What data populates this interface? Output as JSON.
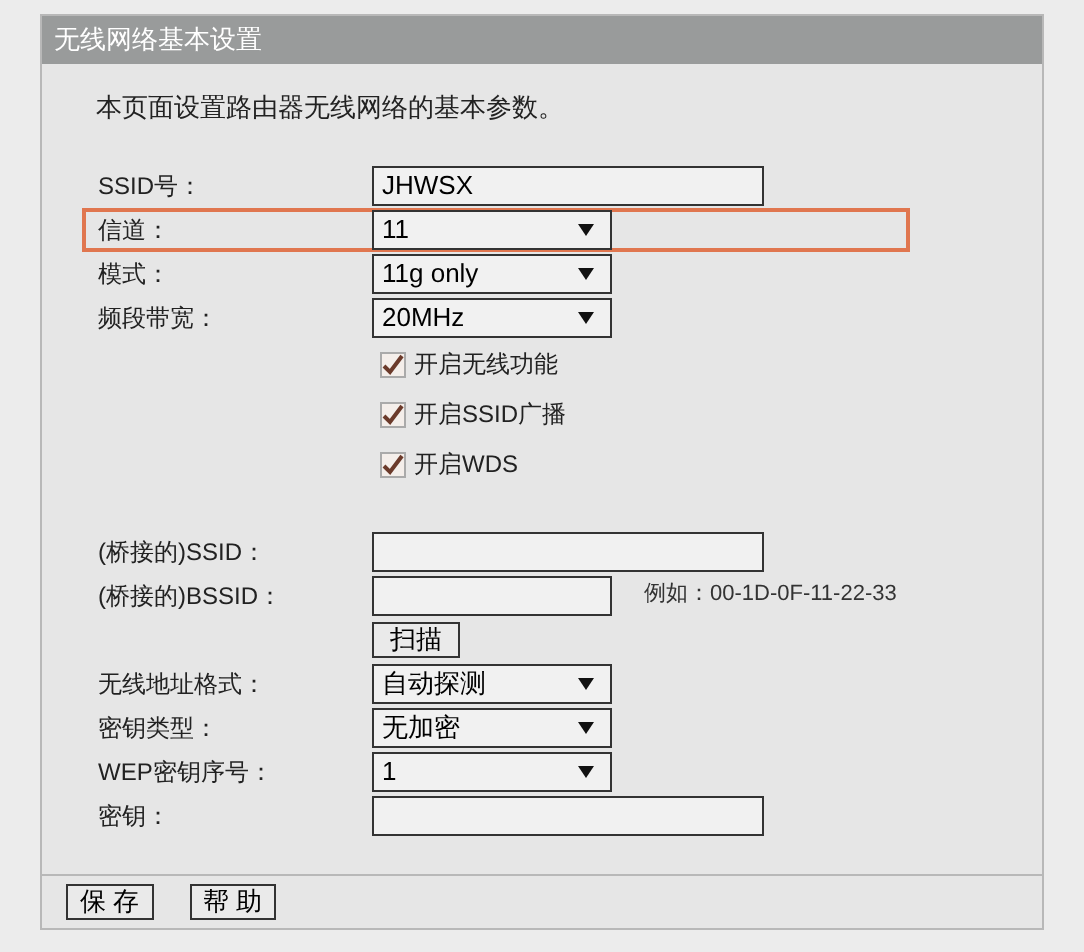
{
  "panel": {
    "title": "无线网络基本设置",
    "description": "本页面设置路由器无线网络的基本参数。"
  },
  "groups": [
    [
      {
        "kind": "text",
        "label": "SSID号：",
        "value": "JHWSX",
        "highlighted": false
      },
      {
        "kind": "select",
        "label": "信道：",
        "value": "11",
        "highlighted": true
      },
      {
        "kind": "select",
        "label": "模式：",
        "value": "11g only",
        "highlighted": false
      },
      {
        "kind": "select",
        "label": "频段带宽：",
        "value": "20MHz",
        "highlighted": false
      },
      {
        "kind": "checkbox",
        "label": "开启无线功能",
        "checked": true,
        "highlighted": false
      },
      {
        "kind": "checkbox",
        "label": "开启SSID广播",
        "checked": true,
        "highlighted": false
      },
      {
        "kind": "checkbox",
        "label": "开启WDS",
        "checked": true,
        "highlighted": false
      }
    ],
    [
      {
        "kind": "text",
        "label": "(桥接的)SSID：",
        "highlighted": false
      },
      {
        "kind": "text",
        "label": "(桥接的)BSSID：",
        "hint": "例如：00-1D-0F-11-22-33",
        "highlighted": false
      },
      {
        "kind": "button",
        "label": "扫描",
        "highlighted": false
      },
      {
        "kind": "select",
        "label": "无线地址格式：",
        "value": "自动探测",
        "highlighted": false
      },
      {
        "kind": "select",
        "label": "密钥类型：",
        "value": "无加密",
        "highlighted": false
      },
      {
        "kind": "select",
        "label": "WEP密钥序号：",
        "value": "1",
        "highlighted": false
      },
      {
        "kind": "text",
        "label": "密钥：",
        "highlighted": false
      }
    ]
  ],
  "footer_buttons": [
    "保 存",
    "帮 助"
  ]
}
